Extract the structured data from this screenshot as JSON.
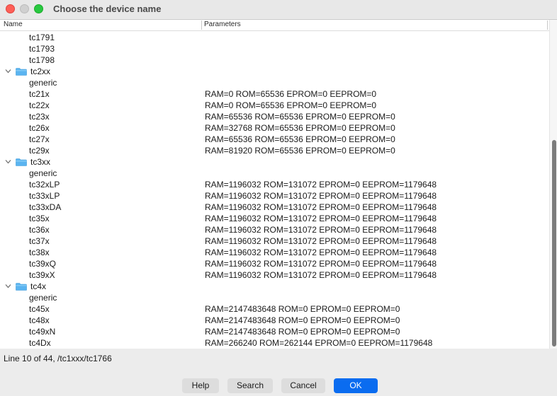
{
  "window": {
    "title": "Choose the device name"
  },
  "table": {
    "headers": {
      "name": "Name",
      "parameters": "Parameters"
    },
    "rows": [
      {
        "name": "tc1791",
        "params": ""
      },
      {
        "name": "tc1793",
        "params": ""
      },
      {
        "name": "tc1798",
        "params": ""
      },
      {
        "name": "tc2xx",
        "params": "",
        "group": true
      },
      {
        "name": "generic",
        "params": ""
      },
      {
        "name": "tc21x",
        "params": "RAM=0 ROM=65536 EPROM=0 EEPROM=0"
      },
      {
        "name": "tc22x",
        "params": "RAM=0 ROM=65536 EPROM=0 EEPROM=0"
      },
      {
        "name": "tc23x",
        "params": "RAM=65536 ROM=65536 EPROM=0 EEPROM=0"
      },
      {
        "name": "tc26x",
        "params": "RAM=32768 ROM=65536 EPROM=0 EEPROM=0"
      },
      {
        "name": "tc27x",
        "params": "RAM=65536 ROM=65536 EPROM=0 EEPROM=0"
      },
      {
        "name": "tc29x",
        "params": "RAM=81920 ROM=65536 EPROM=0 EEPROM=0"
      },
      {
        "name": "tc3xx",
        "params": "",
        "group": true
      },
      {
        "name": "generic",
        "params": ""
      },
      {
        "name": "tc32xLP",
        "params": "RAM=1196032 ROM=131072 EPROM=0 EEPROM=1179648"
      },
      {
        "name": "tc33xLP",
        "params": "RAM=1196032 ROM=131072 EPROM=0 EEPROM=1179648"
      },
      {
        "name": "tc33xDA",
        "params": "RAM=1196032 ROM=131072 EPROM=0 EEPROM=1179648"
      },
      {
        "name": "tc35x",
        "params": "RAM=1196032 ROM=131072 EPROM=0 EEPROM=1179648"
      },
      {
        "name": "tc36x",
        "params": "RAM=1196032 ROM=131072 EPROM=0 EEPROM=1179648"
      },
      {
        "name": "tc37x",
        "params": "RAM=1196032 ROM=131072 EPROM=0 EEPROM=1179648"
      },
      {
        "name": "tc38x",
        "params": "RAM=1196032 ROM=131072 EPROM=0 EEPROM=1179648"
      },
      {
        "name": "tc39xQ",
        "params": "RAM=1196032 ROM=131072 EPROM=0 EEPROM=1179648"
      },
      {
        "name": "tc39xX",
        "params": "RAM=1196032 ROM=131072 EPROM=0 EEPROM=1179648"
      },
      {
        "name": "tc4x",
        "params": "",
        "group": true
      },
      {
        "name": "generic",
        "params": ""
      },
      {
        "name": "tc45x",
        "params": "RAM=2147483648 ROM=0 EPROM=0 EEPROM=0"
      },
      {
        "name": "tc48x",
        "params": "RAM=2147483648 ROM=0 EPROM=0 EEPROM=0"
      },
      {
        "name": "tc49xN",
        "params": "RAM=2147483648 ROM=0 EPROM=0 EEPROM=0"
      },
      {
        "name": "tc4Dx",
        "params": "RAM=266240 ROM=262144 EPROM=0 EEPROM=1179648"
      }
    ]
  },
  "status_text": "Line 10 of 44, /tc1xxx/tc1766",
  "buttons": {
    "help": "Help",
    "search": "Search",
    "cancel": "Cancel",
    "ok": "OK"
  },
  "colors": {
    "accent": "#0a6cf0",
    "folder": "#5ab4f0"
  }
}
